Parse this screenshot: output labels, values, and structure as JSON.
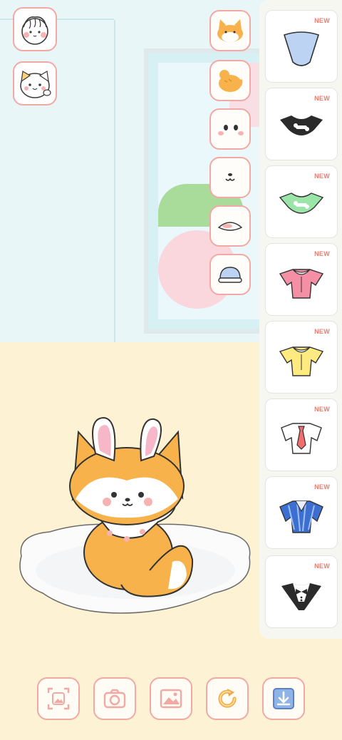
{
  "scene": {
    "wall_color": "#e8f6f8",
    "floor_color": "#fdf3d4",
    "accent_color": "#f2a9a3"
  },
  "left_tabs": [
    {
      "name": "face-preset-human",
      "icon": "human-face-icon"
    },
    {
      "name": "face-preset-cat",
      "icon": "cat-face-icon"
    }
  ],
  "category_tabs": [
    {
      "icon": "fox-head-icon"
    },
    {
      "icon": "body-icon"
    },
    {
      "icon": "eyes-icon"
    },
    {
      "icon": "mouth-icon"
    },
    {
      "icon": "hat-icon"
    },
    {
      "icon": "clothes-icon"
    }
  ],
  "items_panel": {
    "badge_text": "NEW",
    "items": [
      {
        "name": "light-blue-top",
        "badge": "NEW",
        "color": "#bcd3f3"
      },
      {
        "name": "black-bone-collar",
        "badge": "NEW",
        "color": "#2b2b2b"
      },
      {
        "name": "green-bone-collar",
        "badge": "NEW",
        "color": "#9be5a8"
      },
      {
        "name": "pink-collar-shirt",
        "badge": "NEW",
        "color": "#f58fa5"
      },
      {
        "name": "yellow-collar-shirt",
        "badge": "NEW",
        "color": "#fdeb82"
      },
      {
        "name": "white-shirt-red-tie",
        "badge": "NEW",
        "color": "#ffffff"
      },
      {
        "name": "blue-striped-shirt",
        "badge": "NEW",
        "color": "#3d6fd1"
      },
      {
        "name": "tuxedo-bowtie",
        "badge": "NEW",
        "color": "#2b2b2b"
      }
    ]
  },
  "bottom_toolbar": [
    {
      "icon": "frame-capture-icon"
    },
    {
      "icon": "camera-icon"
    },
    {
      "icon": "gallery-icon"
    },
    {
      "icon": "reset-rotate-icon"
    },
    {
      "icon": "download-icon"
    }
  ]
}
